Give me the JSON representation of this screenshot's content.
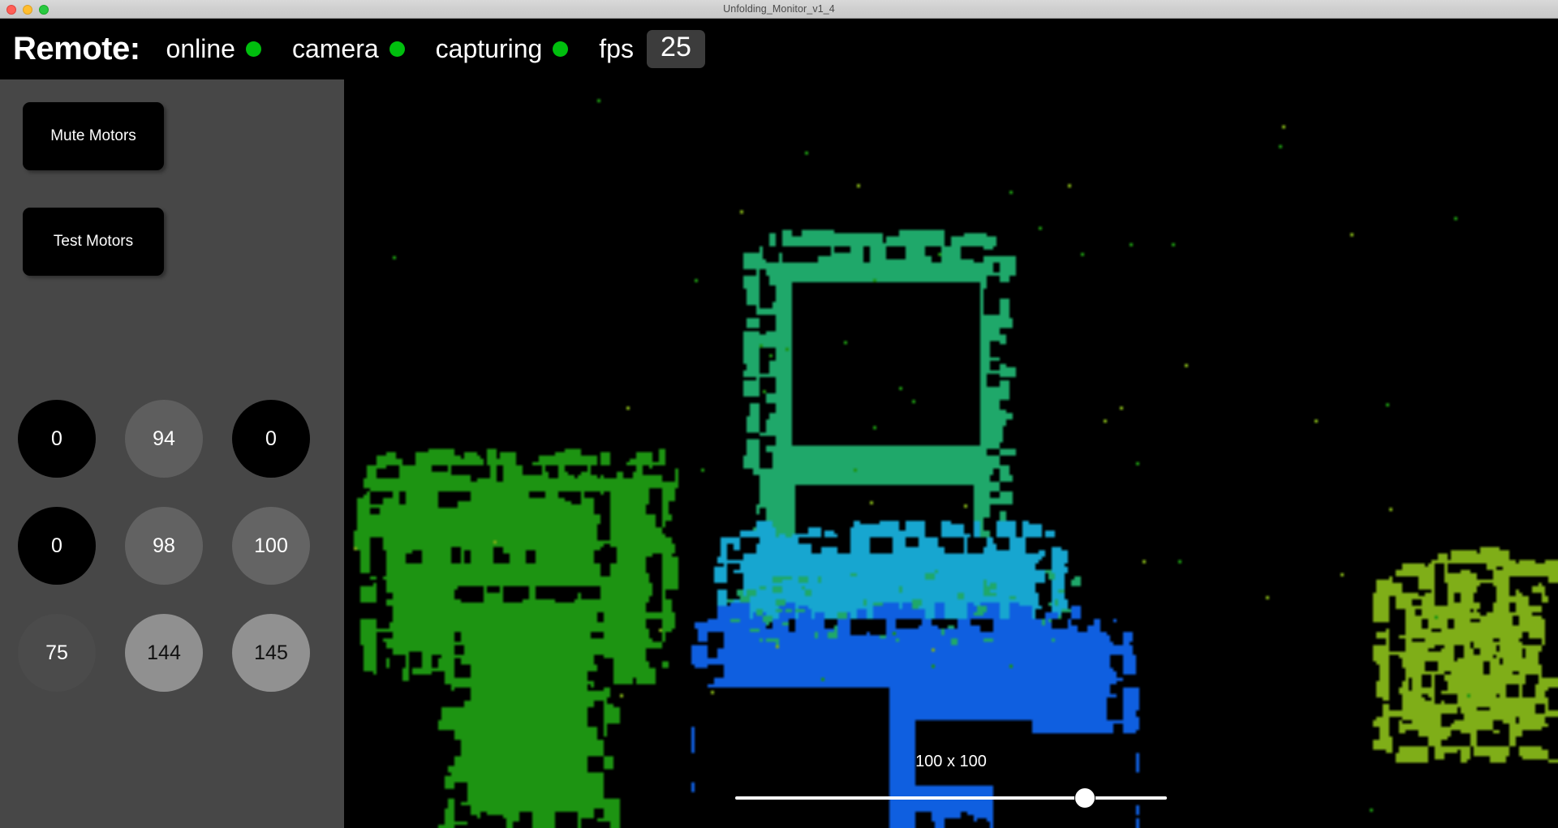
{
  "window": {
    "title": "Unfolding_Monitor_v1_4",
    "controls": {
      "close": "close-button",
      "minimize": "minimize-button",
      "maximize": "maximize-button"
    }
  },
  "header": {
    "title": "Remote:",
    "indicators": [
      {
        "label": "online",
        "led_color": "#00bf0e",
        "state": "on"
      },
      {
        "label": "camera",
        "led_color": "#00bf0e",
        "state": "on"
      },
      {
        "label": "capturing",
        "led_color": "#00bf0e",
        "state": "on"
      }
    ],
    "fps": {
      "label": "fps",
      "value": "25"
    },
    "background": "#000000",
    "text_color": "#ffffff"
  },
  "sidebar": {
    "background": "#474747",
    "buttons": [
      {
        "label": "Mute Motors",
        "background": "#000000",
        "text_color": "#ffffff"
      },
      {
        "label": "Test Motors",
        "background": "#000000",
        "text_color": "#ffffff"
      }
    ],
    "dials": [
      {
        "value": "0",
        "fill": "#000000",
        "text_color": "#ffffff"
      },
      {
        "value": "94",
        "fill": "#5e5e5e",
        "text_color": "#ffffff"
      },
      {
        "value": "0",
        "fill": "#000000",
        "text_color": "#ffffff"
      },
      {
        "value": "0",
        "fill": "#000000",
        "text_color": "#ffffff"
      },
      {
        "value": "98",
        "fill": "#626262",
        "text_color": "#ffffff"
      },
      {
        "value": "100",
        "fill": "#646464",
        "text_color": "#ffffff"
      },
      {
        "value": "75",
        "fill": "#4b4b4b",
        "text_color": "#ffffff"
      },
      {
        "value": "144",
        "fill": "#909090",
        "text_color": "#111111"
      },
      {
        "value": "145",
        "fill": "#919191",
        "text_color": "#111111"
      }
    ]
  },
  "video": {
    "background": "#000000",
    "slider": {
      "caption": "100 x 100",
      "percent": 81,
      "track_color": "#ffffff",
      "thumb_color": "#ffffff"
    },
    "palette": {
      "black": "#000000",
      "green": "#1d9412",
      "teal": "#1fa86a",
      "cyan": "#17a6d0",
      "blue": "#0f5fe0",
      "olive": "#7fae18"
    }
  }
}
